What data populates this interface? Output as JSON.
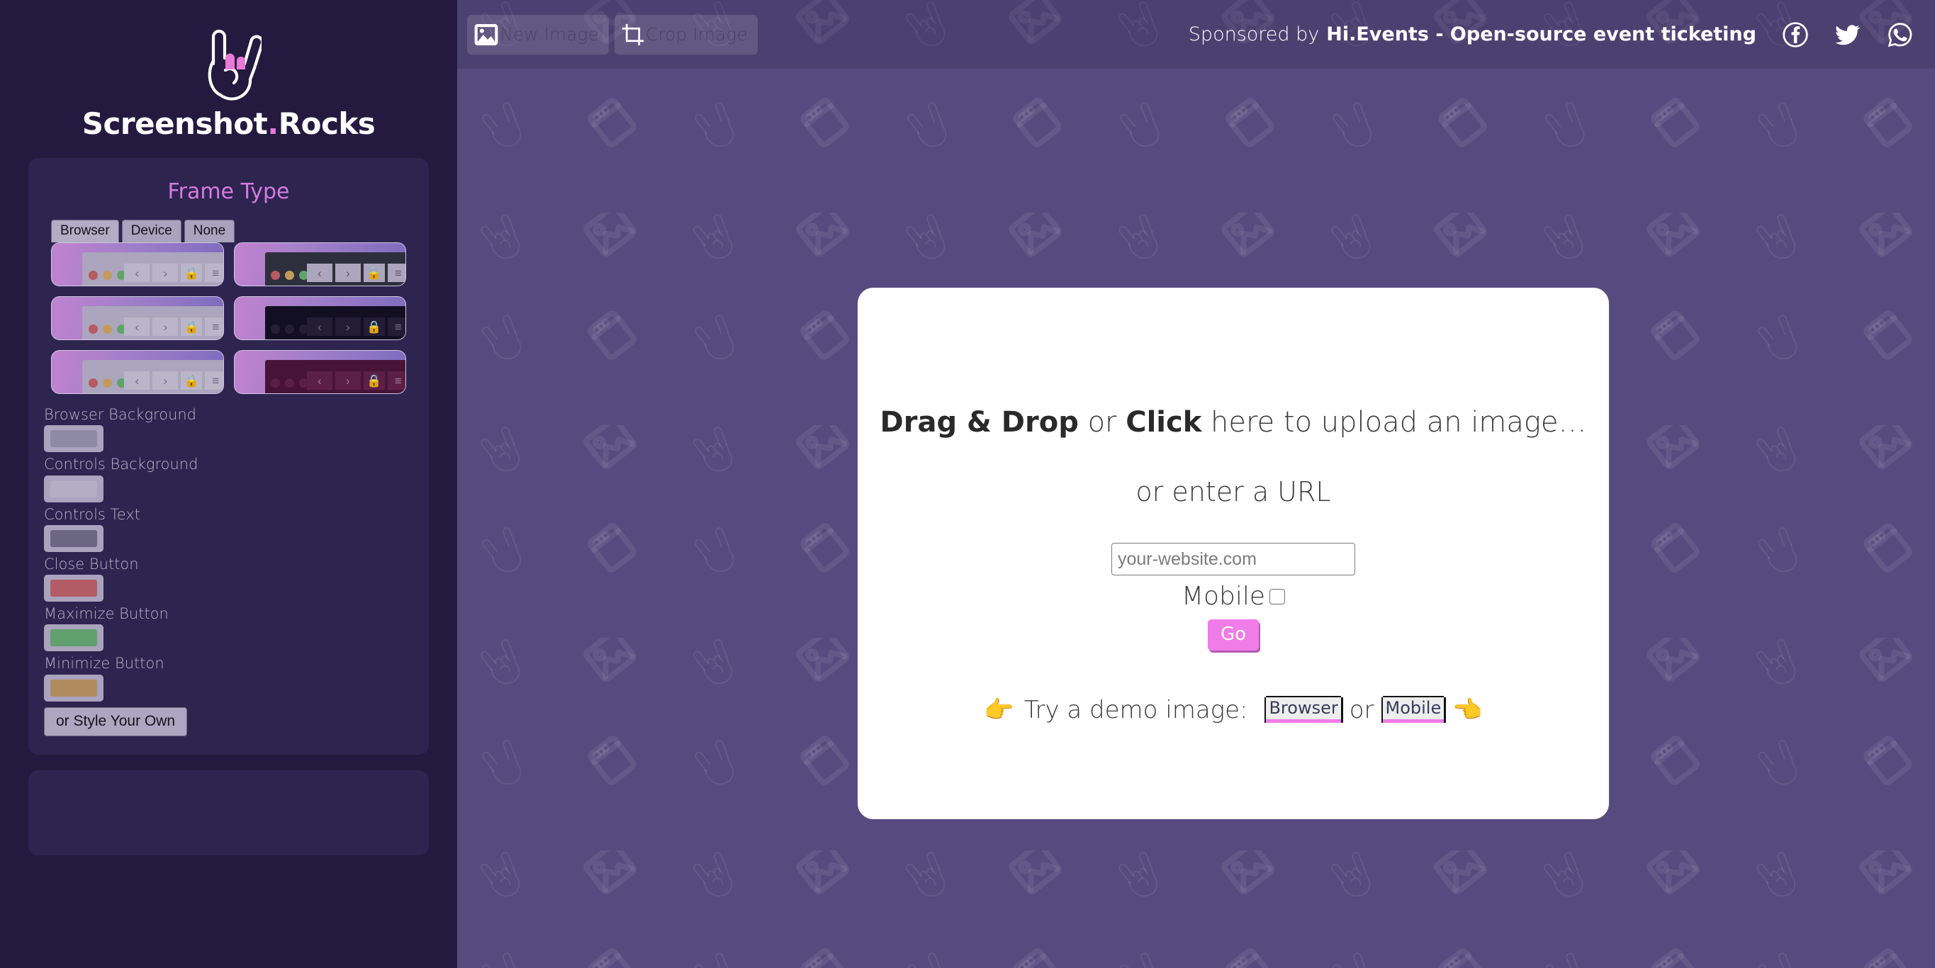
{
  "brand": {
    "name_main": "Screenshot",
    "name_dot": ".",
    "name_suffix": "Rocks",
    "logo_icon": "rock-hand-icon",
    "accent_pink": "#e879d8",
    "sidebar_bg": "#241a40",
    "panel_bg": "#2e2450",
    "canvas_bg": "#564b7e"
  },
  "toolbar": {
    "new_image_label": "New Image",
    "new_image_icon": "image-icon",
    "crop_image_label": "Crop Image",
    "crop_image_icon": "crop-icon"
  },
  "sponsor": {
    "prefix": "Sponsored by",
    "link_text": "Hi.Events - Open-source event ticketing",
    "socials": [
      {
        "name": "facebook-icon",
        "label": "Facebook"
      },
      {
        "name": "twitter-icon",
        "label": "Twitter"
      },
      {
        "name": "whatsapp-icon",
        "label": "WhatsApp"
      }
    ]
  },
  "frame_panel": {
    "title": "Frame Type",
    "tabs": [
      {
        "label": "Browser",
        "active": true
      },
      {
        "label": "Device",
        "active": false
      },
      {
        "label": "None",
        "active": false
      }
    ],
    "thumbs": [
      {
        "variant": "t-light",
        "dots": [
          "#b55b63",
          "#c49a5c",
          "#5fa36a"
        ]
      },
      {
        "variant": "t-dark",
        "dots": [
          "#b55b63",
          "#c49a5c",
          "#5fa36a"
        ]
      },
      {
        "variant": "t-light",
        "dots": [
          "#b55b63",
          "#c49a5c",
          "#5fa36a"
        ]
      },
      {
        "variant": "t-black",
        "dots": [
          "#241f33",
          "#241f33",
          "#241f33"
        ]
      },
      {
        "variant": "t-light",
        "dots": [
          "#b55b63",
          "#c49a5c",
          "#5fa36a"
        ]
      },
      {
        "variant": "t-plum",
        "dots": [
          "#5c2048",
          "#5c2048",
          "#5c2048"
        ]
      }
    ],
    "colors": [
      {
        "label": "Browser Background",
        "value": "#8e89a4"
      },
      {
        "label": "Controls Background",
        "value": "#b4aec5"
      },
      {
        "label": "Controls Text",
        "value": "#6b6682"
      },
      {
        "label": "Close Button",
        "value": "#b45c66"
      },
      {
        "label": "Maximize Button",
        "value": "#5fa06e"
      },
      {
        "label": "Minimize Button",
        "value": "#b08b5e"
      }
    ],
    "style_own_label": "or Style Your Own"
  },
  "upload": {
    "drop_bold_1": "Drag & Drop",
    "drop_mid": " or ",
    "drop_bold_2": "Click",
    "drop_tail": " here to upload an image…",
    "url_prompt": "or enter a URL",
    "url_placeholder": "your-website.com",
    "url_value": "",
    "mobile_label": "Mobile",
    "mobile_checked": false,
    "go_label": "Go",
    "demo_prefix": "Try a demo image:",
    "demo_browser": "Browser",
    "demo_or": "or",
    "demo_mobile": "Mobile",
    "hand_left": "👉",
    "hand_right": "👈"
  }
}
